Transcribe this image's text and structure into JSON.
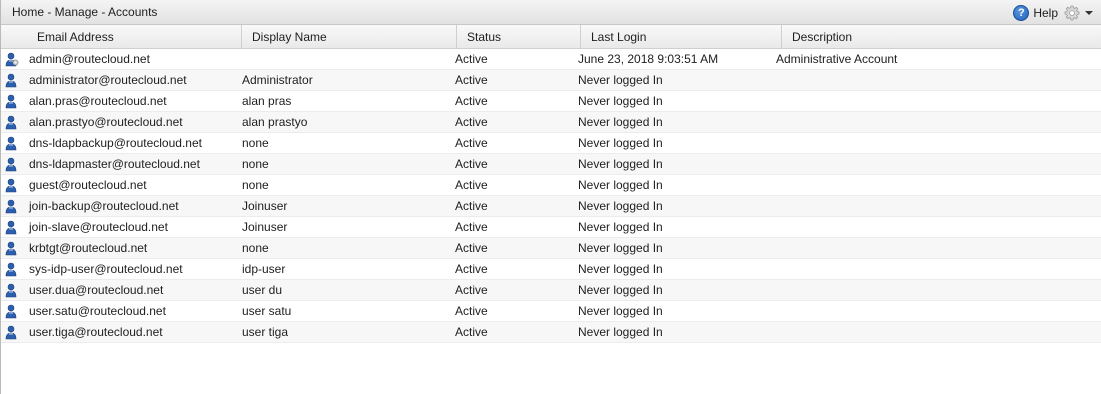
{
  "titlebar": {
    "breadcrumb": "Home - Manage - Accounts",
    "help_label": "Help"
  },
  "columns": {
    "email": "Email Address",
    "display_name": "Display Name",
    "status": "Status",
    "last_login": "Last Login",
    "description": "Description"
  },
  "accounts": [
    {
      "icon": "admin-user-icon",
      "email": "admin@routecloud.net",
      "display_name": "",
      "status": "Active",
      "last_login": "June 23, 2018 9:03:51 AM",
      "description": "Administrative Account"
    },
    {
      "icon": "user-icon",
      "email": "administrator@routecloud.net",
      "display_name": "Administrator",
      "status": "Active",
      "last_login": "Never logged In",
      "description": ""
    },
    {
      "icon": "user-icon",
      "email": "alan.pras@routecloud.net",
      "display_name": "alan pras",
      "status": "Active",
      "last_login": "Never logged In",
      "description": ""
    },
    {
      "icon": "user-icon",
      "email": "alan.prastyo@routecloud.net",
      "display_name": "alan prastyo",
      "status": "Active",
      "last_login": "Never logged In",
      "description": ""
    },
    {
      "icon": "user-icon",
      "email": "dns-ldapbackup@routecloud.net",
      "display_name": "none",
      "status": "Active",
      "last_login": "Never logged In",
      "description": ""
    },
    {
      "icon": "user-icon",
      "email": "dns-ldapmaster@routecloud.net",
      "display_name": "none",
      "status": "Active",
      "last_login": "Never logged In",
      "description": ""
    },
    {
      "icon": "user-icon",
      "email": "guest@routecloud.net",
      "display_name": "none",
      "status": "Active",
      "last_login": "Never logged In",
      "description": ""
    },
    {
      "icon": "user-icon",
      "email": "join-backup@routecloud.net",
      "display_name": "Joinuser",
      "status": "Active",
      "last_login": "Never logged In",
      "description": ""
    },
    {
      "icon": "user-icon",
      "email": "join-slave@routecloud.net",
      "display_name": "Joinuser",
      "status": "Active",
      "last_login": "Never logged In",
      "description": ""
    },
    {
      "icon": "user-icon",
      "email": "krbtgt@routecloud.net",
      "display_name": "none",
      "status": "Active",
      "last_login": "Never logged In",
      "description": ""
    },
    {
      "icon": "user-icon",
      "email": "sys-idp-user@routecloud.net",
      "display_name": "idp-user",
      "status": "Active",
      "last_login": "Never logged In",
      "description": ""
    },
    {
      "icon": "user-icon",
      "email": "user.dua@routecloud.net",
      "display_name": "user du",
      "status": "Active",
      "last_login": "Never logged In",
      "description": ""
    },
    {
      "icon": "user-icon",
      "email": "user.satu@routecloud.net",
      "display_name": "user satu",
      "status": "Active",
      "last_login": "Never logged In",
      "description": ""
    },
    {
      "icon": "user-icon",
      "email": "user.tiga@routecloud.net",
      "display_name": "user tiga",
      "status": "Active",
      "last_login": "Never logged In",
      "description": ""
    }
  ],
  "colors": {
    "accent": "#1f5fb8",
    "user_icon": "#2c5fae"
  }
}
